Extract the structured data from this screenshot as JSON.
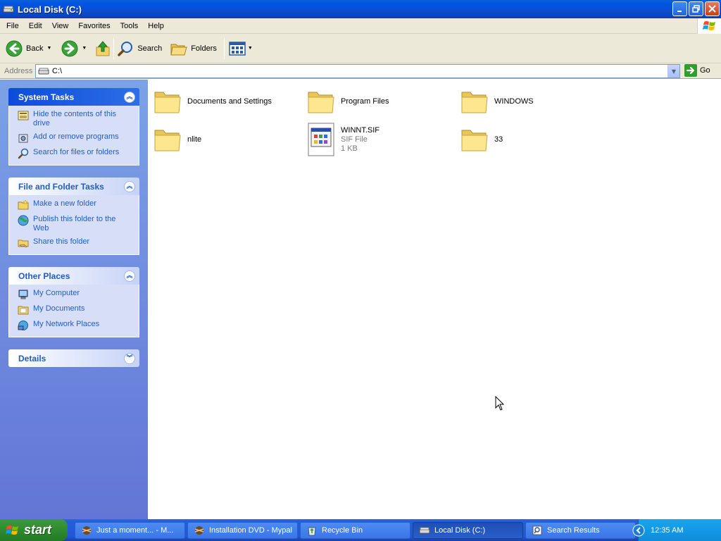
{
  "window": {
    "title": "Local Disk (C:)",
    "icon": "drive-icon",
    "buttons": [
      "minimize-icon",
      "restore-icon",
      "close-icon"
    ]
  },
  "menu": [
    "File",
    "Edit",
    "View",
    "Favorites",
    "Tools",
    "Help"
  ],
  "toolbar": {
    "back_label": "Back",
    "search_label": "Search",
    "folders_label": "Folders"
  },
  "address": {
    "label": "Address",
    "value": "C:\\",
    "go_label": "Go"
  },
  "taskpane": {
    "system_tasks": {
      "title": "System Tasks",
      "items": [
        {
          "label": "Hide the contents of this drive",
          "icon": "hide-contents-icon"
        },
        {
          "label": "Add or remove programs",
          "icon": "add-remove-programs-icon"
        },
        {
          "label": "Search for files or folders",
          "icon": "search-icon"
        }
      ]
    },
    "file_folder_tasks": {
      "title": "File and Folder Tasks",
      "items": [
        {
          "label": "Make a new folder",
          "icon": "new-folder-icon"
        },
        {
          "label": "Publish this folder to the Web",
          "icon": "publish-web-icon"
        },
        {
          "label": "Share this folder",
          "icon": "share-folder-icon"
        }
      ]
    },
    "other_places": {
      "title": "Other Places",
      "items": [
        {
          "label": "My Computer",
          "icon": "my-computer-icon"
        },
        {
          "label": "My Documents",
          "icon": "my-documents-icon"
        },
        {
          "label": "My Network Places",
          "icon": "network-places-icon"
        }
      ]
    },
    "details": {
      "title": "Details"
    }
  },
  "files": [
    {
      "name": "Documents and Settings",
      "type": "folder"
    },
    {
      "name": "Program Files",
      "type": "folder"
    },
    {
      "name": "WINDOWS",
      "type": "folder"
    },
    {
      "name": "nlite",
      "type": "folder"
    },
    {
      "name": "WINNT.SIF",
      "type": "file",
      "kind": "SIF File",
      "size": "1 KB"
    },
    {
      "name": "33",
      "type": "folder"
    }
  ],
  "taskbar": {
    "start_label": "start",
    "tasks": [
      {
        "label": "Just a moment... - M...",
        "active": false
      },
      {
        "label": "Installation DVD - Mypal",
        "active": false
      },
      {
        "label": "Recycle Bin",
        "active": false
      },
      {
        "label": "Local Disk (C:)",
        "active": true
      },
      {
        "label": "Search Results",
        "active": false
      }
    ],
    "clock": "12:35 AM"
  }
}
